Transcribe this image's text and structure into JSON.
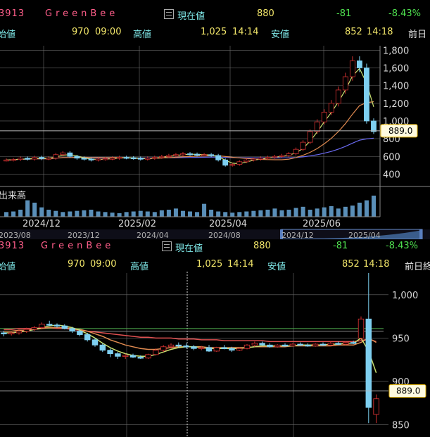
{
  "panels": [
    {
      "header": {
        "code": "3913",
        "name": "GreenBee",
        "current_label": "現在値",
        "current": "880",
        "change": "-81",
        "change_pct": "-8.43%"
      },
      "stats": {
        "open_label": "始値",
        "open": "970",
        "open_time": "09:00",
        "high_label": "高値",
        "high": "1,025",
        "high_time": "14:14",
        "low_label": "安値",
        "low": "852",
        "low_time": "14:18",
        "prev_label": "前日"
      }
    },
    {
      "header": {
        "code": "3913",
        "name": "GreenBee",
        "current_label": "現在値",
        "current": "880",
        "change": "-81",
        "change_pct": "-8.43%"
      },
      "stats": {
        "open_label": "始値",
        "open": "970",
        "open_time": "09:00",
        "high_label": "高値",
        "high": "1,025",
        "high_time": "14:14",
        "low_label": "安値",
        "low": "852",
        "low_time": "14:18",
        "prev_label": "前日終"
      }
    }
  ],
  "colors": {
    "up": "#d03030",
    "down": "#7ecff0",
    "ma_short": "#c8e070",
    "ma_mid": "#e08a50",
    "ma_long": "#6a6af0",
    "grid": "#6a6a6a",
    "price_line": "#b8b8b8"
  },
  "chart_data": [
    {
      "type": "candlestick",
      "period": "daily",
      "yticks": [
        400,
        600,
        800,
        1000,
        1200,
        1400,
        1600,
        1800
      ],
      "ytick_labels": [
        "400",
        "600",
        "800",
        "1,000",
        "1,200",
        "1,400",
        "1,600",
        "1,800"
      ],
      "ylim": [
        300,
        1850
      ],
      "xticks": [
        "2024/12",
        "2025/02",
        "2025/04",
        "2025/06"
      ],
      "price_label": "889.0",
      "closes": [
        560,
        565,
        580,
        570,
        590,
        575,
        580,
        620,
        640,
        600,
        580,
        570,
        560,
        570,
        575,
        580,
        590,
        585,
        580,
        570,
        580,
        590,
        600,
        610,
        620,
        630,
        625,
        615,
        620,
        610,
        560,
        500,
        510,
        540,
        560,
        570,
        580,
        590,
        600,
        610,
        630,
        680,
        760,
        880,
        990,
        1100,
        1200,
        1350,
        1500,
        1680,
        1600,
        1000,
        880
      ],
      "volume": {
        "label": "出来高",
        "values": [
          40,
          45,
          60,
          140,
          120,
          80,
          60,
          50,
          40,
          45,
          50,
          55,
          60,
          45,
          40,
          35,
          30,
          40,
          45,
          50,
          45,
          40,
          55,
          60,
          70,
          50,
          45,
          40,
          110,
          60,
          45,
          40,
          35,
          40,
          45,
          50,
          55,
          60,
          70,
          55,
          60,
          75,
          85,
          60,
          70,
          80,
          90,
          70,
          85,
          95,
          120,
          140,
          180
        ]
      },
      "navigator": {
        "xticks": [
          "2023/08",
          "2023/12",
          "2024/04",
          "2024/08",
          "2024/12",
          "2025/04"
        ]
      }
    },
    {
      "type": "candlestick",
      "period": "intraday",
      "yticks": [
        850,
        900,
        950,
        1000
      ],
      "ytick_labels": [
        "850",
        "900",
        "950",
        "1,000"
      ],
      "ylim": [
        840,
        1025
      ],
      "price_label": "889.0",
      "candles": [
        {
          "o": 956,
          "h": 958,
          "l": 952,
          "c": 955
        },
        {
          "o": 955,
          "h": 957,
          "l": 953,
          "c": 956
        },
        {
          "o": 956,
          "h": 960,
          "l": 954,
          "c": 958
        },
        {
          "o": 958,
          "h": 962,
          "l": 956,
          "c": 960
        },
        {
          "o": 960,
          "h": 964,
          "l": 958,
          "c": 962
        },
        {
          "o": 962,
          "h": 968,
          "l": 960,
          "c": 966
        },
        {
          "o": 966,
          "h": 970,
          "l": 964,
          "c": 965
        },
        {
          "o": 965,
          "h": 967,
          "l": 962,
          "c": 964
        },
        {
          "o": 964,
          "h": 966,
          "l": 960,
          "c": 961
        },
        {
          "o": 961,
          "h": 963,
          "l": 956,
          "c": 958
        },
        {
          "o": 958,
          "h": 960,
          "l": 952,
          "c": 954
        },
        {
          "o": 954,
          "h": 956,
          "l": 946,
          "c": 948
        },
        {
          "o": 948,
          "h": 950,
          "l": 940,
          "c": 942
        },
        {
          "o": 942,
          "h": 944,
          "l": 934,
          "c": 936
        },
        {
          "o": 936,
          "h": 938,
          "l": 928,
          "c": 932
        },
        {
          "o": 932,
          "h": 934,
          "l": 926,
          "c": 929
        },
        {
          "o": 929,
          "h": 932,
          "l": 926,
          "c": 930
        },
        {
          "o": 930,
          "h": 932,
          "l": 927,
          "c": 928
        },
        {
          "o": 928,
          "h": 930,
          "l": 926,
          "c": 927
        },
        {
          "o": 927,
          "h": 932,
          "l": 926,
          "c": 931
        },
        {
          "o": 931,
          "h": 938,
          "l": 930,
          "c": 936
        },
        {
          "o": 936,
          "h": 942,
          "l": 934,
          "c": 940
        },
        {
          "o": 940,
          "h": 944,
          "l": 938,
          "c": 942
        },
        {
          "o": 942,
          "h": 945,
          "l": 939,
          "c": 941
        },
        {
          "o": 941,
          "h": 944,
          "l": 938,
          "c": 940
        },
        {
          "o": 940,
          "h": 942,
          "l": 936,
          "c": 938
        },
        {
          "o": 938,
          "h": 941,
          "l": 936,
          "c": 939
        },
        {
          "o": 939,
          "h": 942,
          "l": 934,
          "c": 935
        },
        {
          "o": 935,
          "h": 940,
          "l": 934,
          "c": 939
        },
        {
          "o": 939,
          "h": 942,
          "l": 937,
          "c": 938
        },
        {
          "o": 938,
          "h": 940,
          "l": 934,
          "c": 936
        },
        {
          "o": 936,
          "h": 939,
          "l": 935,
          "c": 938
        },
        {
          "o": 938,
          "h": 943,
          "l": 937,
          "c": 942
        },
        {
          "o": 942,
          "h": 946,
          "l": 940,
          "c": 944
        },
        {
          "o": 944,
          "h": 946,
          "l": 941,
          "c": 942
        },
        {
          "o": 942,
          "h": 944,
          "l": 939,
          "c": 940
        },
        {
          "o": 940,
          "h": 943,
          "l": 939,
          "c": 942
        },
        {
          "o": 942,
          "h": 944,
          "l": 940,
          "c": 941
        },
        {
          "o": 941,
          "h": 944,
          "l": 940,
          "c": 943
        },
        {
          "o": 943,
          "h": 945,
          "l": 941,
          "c": 942
        },
        {
          "o": 942,
          "h": 944,
          "l": 940,
          "c": 941
        },
        {
          "o": 941,
          "h": 944,
          "l": 940,
          "c": 943
        },
        {
          "o": 943,
          "h": 945,
          "l": 941,
          "c": 942
        },
        {
          "o": 942,
          "h": 946,
          "l": 941,
          "c": 944
        },
        {
          "o": 944,
          "h": 946,
          "l": 942,
          "c": 943
        },
        {
          "o": 943,
          "h": 946,
          "l": 942,
          "c": 945
        },
        {
          "o": 945,
          "h": 947,
          "l": 943,
          "c": 944
        },
        {
          "o": 950,
          "h": 975,
          "l": 948,
          "c": 972
        },
        {
          "o": 972,
          "h": 1025,
          "l": 852,
          "c": 870
        },
        {
          "o": 862,
          "h": 885,
          "l": 852,
          "c": 880
        }
      ],
      "ma": [
        {
          "color": "#e05050",
          "values": [
            960,
            960,
            961,
            961,
            961,
            962,
            962,
            961,
            961,
            960,
            959,
            958,
            957,
            956,
            955,
            954,
            953,
            952,
            951,
            951,
            950,
            950,
            950,
            949,
            949,
            949,
            948,
            948,
            948,
            947,
            947,
            947,
            947,
            947,
            947,
            946,
            946,
            946,
            946,
            946,
            946,
            946,
            946,
            946,
            946,
            946,
            946,
            947,
            949,
            946
          ]
        },
        {
          "color": "#e08a50",
          "values": [
            958,
            958,
            959,
            959,
            960,
            961,
            962,
            962,
            962,
            961,
            960,
            958,
            955,
            952,
            948,
            945,
            942,
            940,
            938,
            937,
            937,
            938,
            939,
            940,
            940,
            940,
            940,
            939,
            939,
            939,
            939,
            939,
            939,
            940,
            940,
            940,
            940,
            940,
            941,
            941,
            941,
            941,
            941,
            941,
            942,
            942,
            942,
            945,
            950,
            945
          ]
        },
        {
          "color": "#c8e070",
          "values": [
            956,
            956,
            957,
            958,
            960,
            962,
            964,
            965,
            964,
            962,
            959,
            955,
            950,
            944,
            939,
            935,
            932,
            930,
            929,
            929,
            931,
            934,
            937,
            939,
            940,
            940,
            939,
            938,
            938,
            938,
            938,
            938,
            939,
            940,
            941,
            941,
            941,
            941,
            941,
            942,
            942,
            942,
            942,
            943,
            943,
            944,
            944,
            950,
            935,
            910
          ]
        }
      ],
      "reference_lines": [
        961,
        958
      ]
    }
  ]
}
